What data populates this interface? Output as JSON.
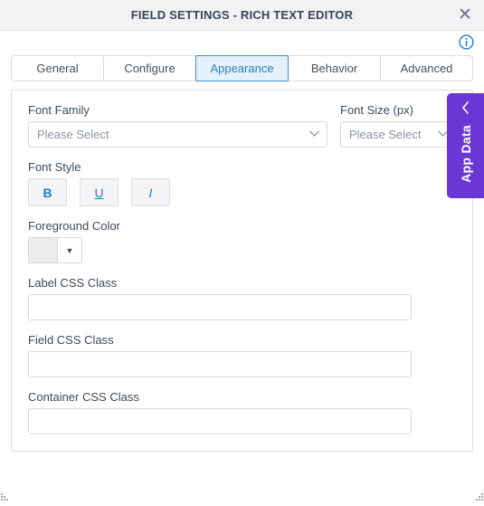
{
  "window": {
    "title": "FIELD SETTINGS - RICH TEXT EDITOR",
    "close_label": "✕",
    "close_icon": "close-icon"
  },
  "header": {
    "info_icon": "info-circle-icon"
  },
  "tabs": [
    {
      "label": "General",
      "active": false
    },
    {
      "label": "Configure",
      "active": false
    },
    {
      "label": "Appearance",
      "active": true
    },
    {
      "label": "Behavior",
      "active": false
    },
    {
      "label": "Advanced",
      "active": false
    }
  ],
  "form": {
    "font_family": {
      "label": "Font Family",
      "value": "Please Select",
      "chevron": "⌄"
    },
    "font_size": {
      "label": "Font Size (px)",
      "value": "Please Select",
      "chevron": "⌄"
    },
    "font_style": {
      "label": "Font Style",
      "buttons": [
        {
          "label": "B",
          "name": "bold-button"
        },
        {
          "label": "U",
          "name": "underline-button"
        },
        {
          "label": "I",
          "name": "italic-button"
        }
      ]
    },
    "foreground_color": {
      "label": "Foreground Color",
      "swatch_color": "#ececed",
      "arrow": "▼"
    },
    "label_css_class": {
      "label": "Label CSS Class",
      "value": "",
      "placeholder": ""
    },
    "field_css_class": {
      "label": "Field CSS Class",
      "value": "",
      "placeholder": ""
    },
    "container_css_class": {
      "label": "Container CSS Class",
      "value": "",
      "placeholder": ""
    }
  },
  "app_data_tab": {
    "label": "App Data",
    "chevron": "‹",
    "color": "#6b37d4"
  },
  "theme": {
    "accent_blue": "#2a7fc4",
    "active_tab_bg": "#e4f1fb",
    "titlebar_bg": "#f2f2f4",
    "label_color": "#3d4a5c"
  }
}
